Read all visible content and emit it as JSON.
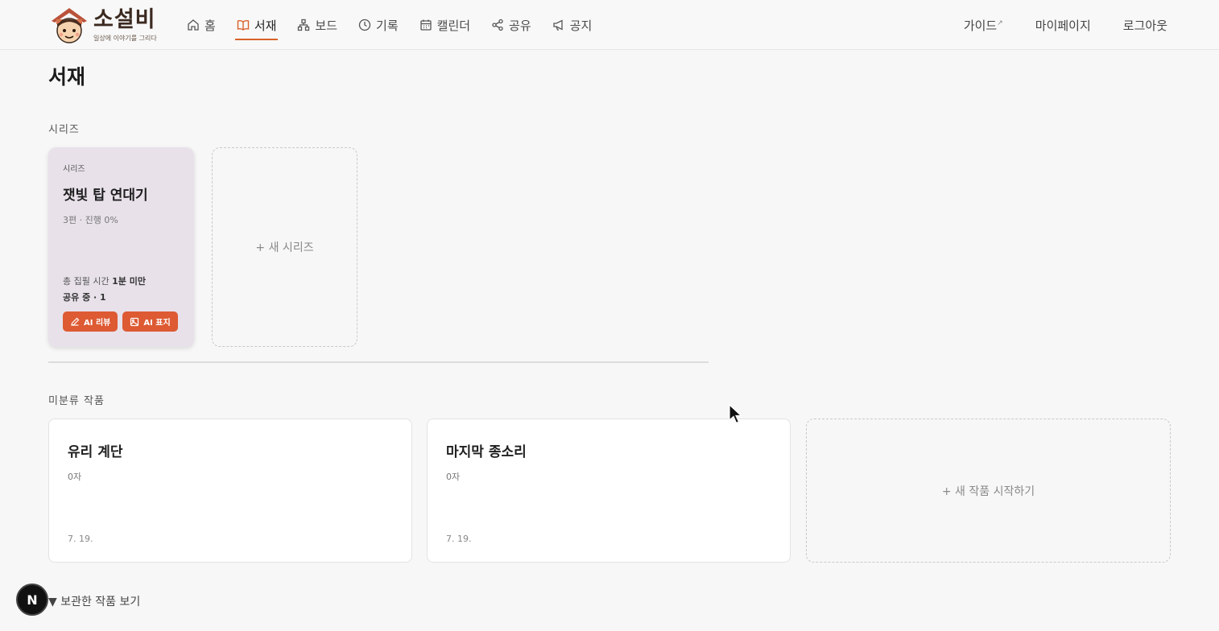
{
  "header": {
    "logo_title": "소설비",
    "logo_subtitle": "일상에 이야기를 그리다",
    "nav": [
      {
        "label": "홈",
        "icon": "home-icon"
      },
      {
        "label": "서재",
        "icon": "book-icon",
        "active": true
      },
      {
        "label": "보드",
        "icon": "board-icon"
      },
      {
        "label": "기록",
        "icon": "clock-icon"
      },
      {
        "label": "캘린더",
        "icon": "calendar-icon"
      },
      {
        "label": "공유",
        "icon": "share-icon"
      },
      {
        "label": "공지",
        "icon": "megaphone-icon"
      }
    ],
    "right": {
      "guide": "가이드",
      "guide_mark": "↗",
      "mypage": "마이페이지",
      "logout": "로그아웃"
    }
  },
  "page": {
    "title": "서재"
  },
  "series_section": {
    "label": "시리즈",
    "card": {
      "tag": "시리즈",
      "title": "잿빛 탑 연대기",
      "meta": "3편 · 진행 0%",
      "time_label": "총 집필 시간",
      "time_value": "1분 미만",
      "share": "공유 중 · 1",
      "btn_review": "AI 리뷰",
      "btn_cover": "AI 표지"
    },
    "new_series": "+ 새 시리즈"
  },
  "works_section": {
    "label": "미분류 작품",
    "works": [
      {
        "title": "유리 계단",
        "count": "0자",
        "date": "7. 19."
      },
      {
        "title": "마지막 종소리",
        "count": "0자",
        "date": "7. 19."
      }
    ],
    "new_work": "+ 새 작품 시작하기"
  },
  "archive_toggle": "▼ 보관한 작품 보기",
  "badge": "N",
  "colors": {
    "accent": "#d9622b",
    "ai_button": "#dd5a33",
    "series_card_bg": "#e8e1ea"
  }
}
